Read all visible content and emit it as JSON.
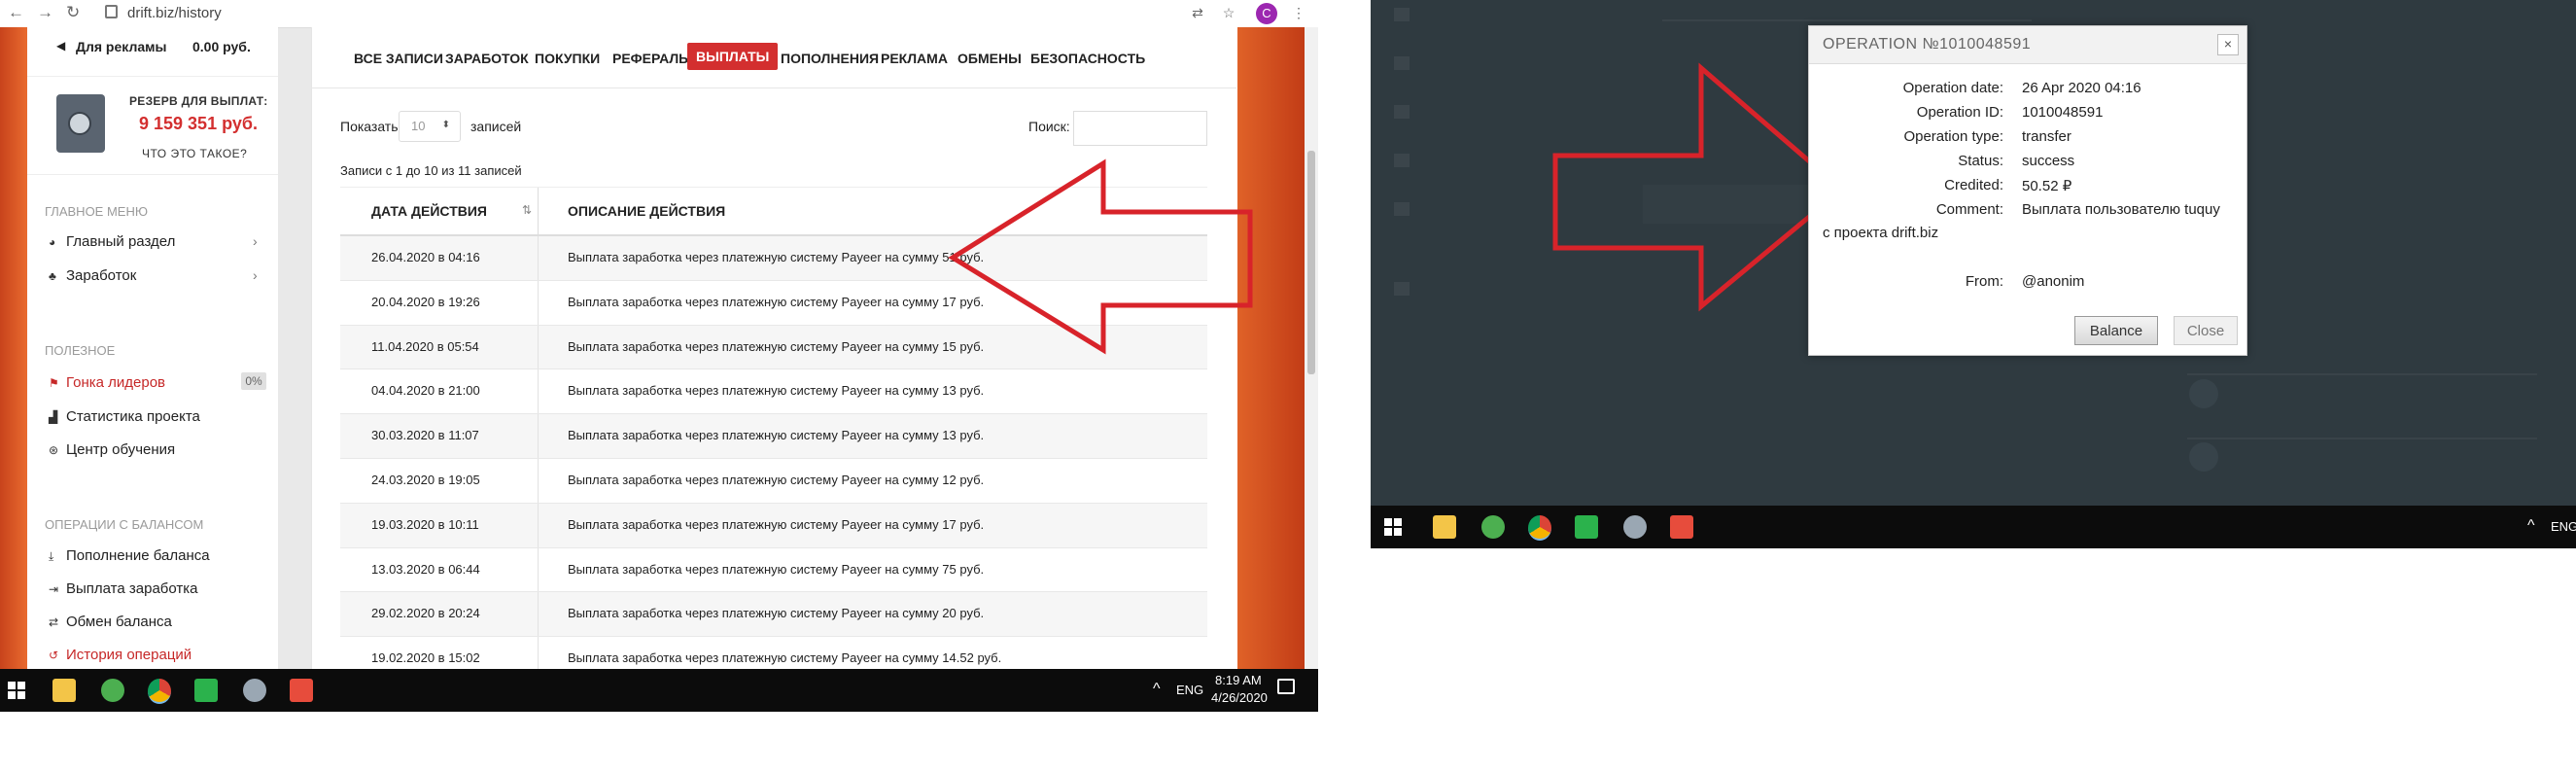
{
  "browser": {
    "url": "drift.biz/history",
    "profile_initial": "C"
  },
  "sidebar": {
    "ads_label": "Для рекламы",
    "ads_value": "0.00 руб.",
    "reserve_title": "РЕЗЕРВ ДЛЯ ВЫПЛАТ:",
    "reserve_amount": "9 159 351 руб.",
    "reserve_what": "ЧТО ЭТО ТАКОЕ?",
    "sections": [
      {
        "title": "ГЛАВНОЕ МЕНЮ",
        "items": [
          {
            "label": "Главный раздел",
            "icon": "dashboard-icon"
          },
          {
            "label": "Заработок",
            "icon": "money-bag-icon"
          }
        ]
      },
      {
        "title": "ПОЛЕЗНОЕ",
        "items": [
          {
            "label": "Гонка лидеров",
            "icon": "flag-icon",
            "badge": "0%"
          },
          {
            "label": "Статистика проекта",
            "icon": "chart-icon"
          },
          {
            "label": "Центр обучения",
            "icon": "lifebuoy-icon"
          }
        ]
      },
      {
        "title": "ОПЕРАЦИИ С БАЛАНСОМ",
        "items": [
          {
            "label": "Пополнение баланса",
            "icon": "download-icon"
          },
          {
            "label": "Выплата заработка",
            "icon": "sign-out-icon"
          },
          {
            "label": "Обмен баланса",
            "icon": "exchange-icon"
          },
          {
            "label": "История операций",
            "icon": "history-icon"
          }
        ]
      }
    ]
  },
  "tabs": [
    "ВСЕ ЗАПИСИ",
    "ЗАРАБОТОК",
    "ПОКУПКИ",
    "РЕФЕРАЛЫ",
    "ВЫПЛАТЫ",
    "ПОПОЛНЕНИЯ",
    "РЕКЛАМА",
    "ОБМЕНЫ",
    "БЕЗОПАСНОСТЬ"
  ],
  "active_tab": "ВЫПЛАТЫ",
  "table_controls": {
    "show_label": "Показать",
    "show_value": "10",
    "show_suffix": "записей",
    "search_label": "Поиск:",
    "info": "Записи с 1 до 10 из 11 записей"
  },
  "table": {
    "headers": [
      "ДАТА ДЕЙСТВИЯ",
      "ОПИСАНИЕ ДЕЙСТВИЯ"
    ],
    "rows": [
      [
        "26.04.2020 в 04:16",
        "Выплата заработка через платежную систему Payeer на сумму 51 руб."
      ],
      [
        "20.04.2020 в 19:26",
        "Выплата заработка через платежную систему Payeer на сумму 17 руб."
      ],
      [
        "11.04.2020 в 05:54",
        "Выплата заработка через платежную систему Payeer на сумму 15 руб."
      ],
      [
        "04.04.2020 в 21:00",
        "Выплата заработка через платежную систему Payeer на сумму 13 руб."
      ],
      [
        "30.03.2020 в 11:07",
        "Выплата заработка через платежную систему Payeer на сумму 13 руб."
      ],
      [
        "24.03.2020 в 19:05",
        "Выплата заработка через платежную систему Payeer на сумму 12 руб."
      ],
      [
        "19.03.2020 в 10:11",
        "Выплата заработка через платежную систему Payeer на сумму 17 руб."
      ],
      [
        "13.03.2020 в 06:44",
        "Выплата заработка через платежную систему Payeer на сумму 75 руб."
      ],
      [
        "29.02.2020 в 20:24",
        "Выплата заработка через платежную систему Payeer на сумму 20 руб."
      ],
      [
        "19.02.2020 в 15:02",
        "Выплата заработка через платежную систему Payeer на сумму 14.52 руб."
      ]
    ]
  },
  "taskbar_left": {
    "lang": "ENG",
    "time": "8:19 AM",
    "date": "4/26/2020"
  },
  "modal": {
    "title": "OPERATION №1010048591",
    "fields": [
      {
        "key": "Operation date:",
        "value": "26 Apr 2020 04:16"
      },
      {
        "key": "Operation ID:",
        "value": "1010048591"
      },
      {
        "key": "Operation type:",
        "value": "transfer"
      },
      {
        "key": "Status:",
        "value": "success"
      },
      {
        "key": "Credited:",
        "value": "50.52 ₽"
      },
      {
        "key": "Comment:",
        "value": "Выплата пользователю tuquy"
      }
    ],
    "comment_cont": "с проекта drift.biz",
    "from_key": "From:",
    "from_value": "@anonim",
    "balance_btn": "Balance",
    "close_btn": "Close"
  },
  "taskbar_right": {
    "lang": "ENG"
  },
  "colors": {
    "accent_red": "#d32f2f",
    "arrow_red": "#d8232a",
    "dark_bg": "#2f3a40",
    "taskbar": "#0c0c0c"
  }
}
